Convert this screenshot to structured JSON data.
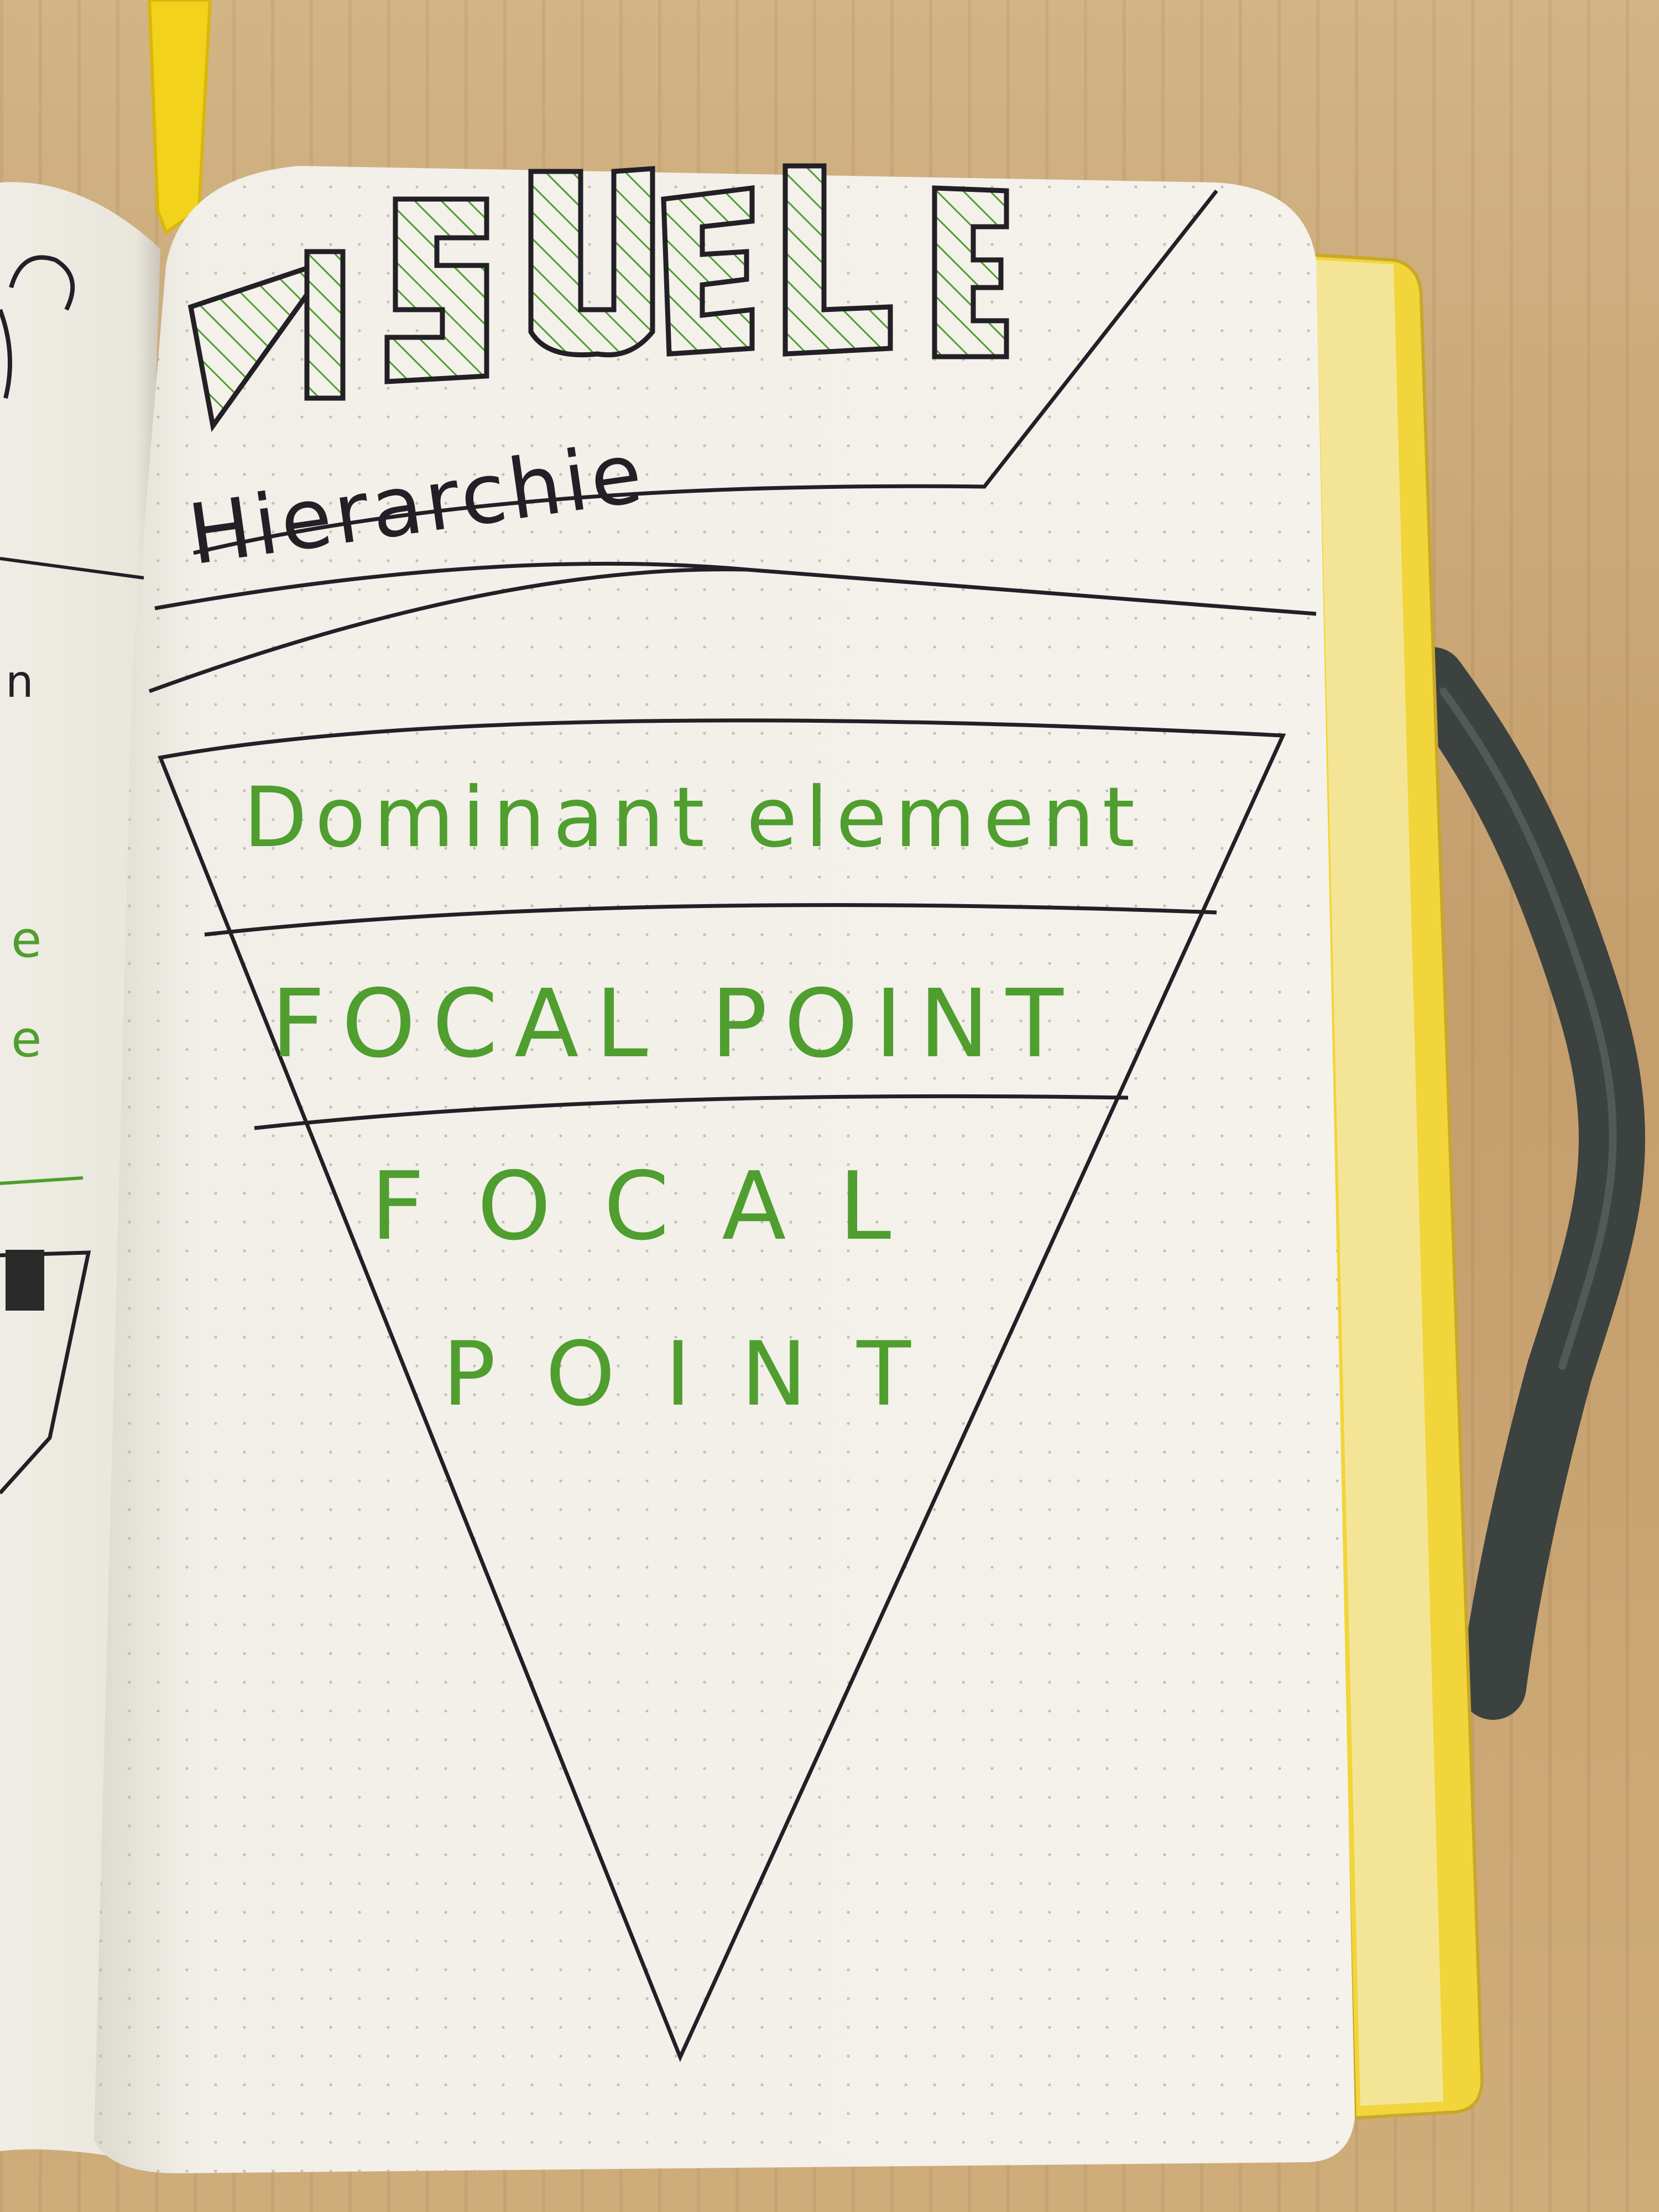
{
  "title": {
    "word": "VISUELE",
    "letters": [
      "V",
      "I",
      "S",
      "U",
      "E",
      "L",
      "E"
    ],
    "subtitle": "Hierarchie"
  },
  "pyramid": {
    "levels": [
      {
        "lines": [
          "Dominant element"
        ]
      },
      {
        "lines": [
          "FOCAL POINT"
        ]
      },
      {
        "lines": [
          "FOCAL",
          "POINT"
        ]
      }
    ]
  },
  "left_page": {
    "fragments": [
      "n",
      "e",
      "e"
    ]
  },
  "colors": {
    "ink_green": "#4f9e2f",
    "ink_black": "#222026",
    "paper": "#f3f1ea",
    "ribbon": "#f2d21a",
    "elastic_band": "#3b4240",
    "table": "#c9a878"
  },
  "icons": [
    "bookmark-ribbon",
    "elastic-band"
  ]
}
